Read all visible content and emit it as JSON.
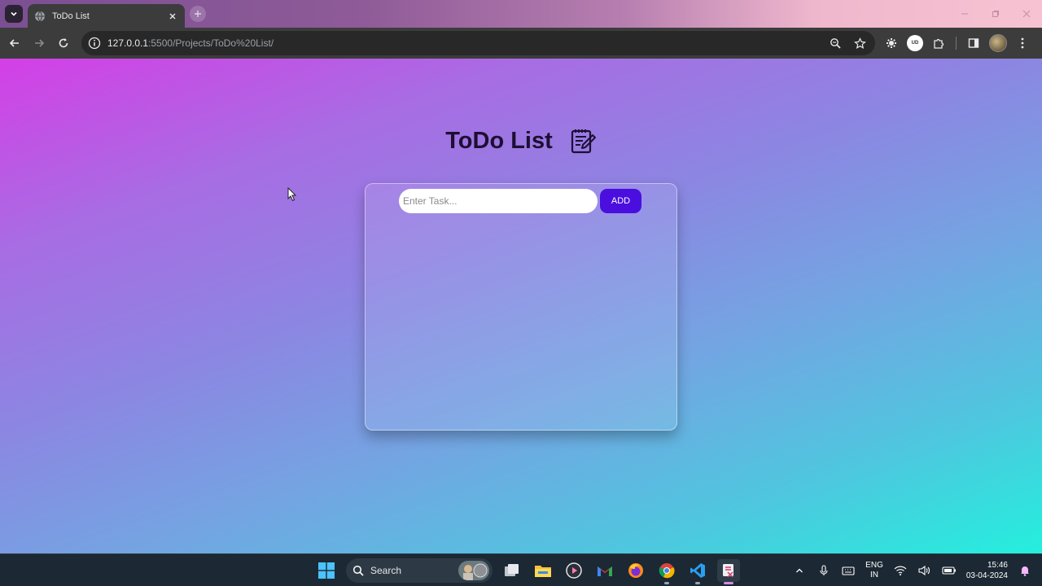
{
  "browser": {
    "tab_title": "ToDo List",
    "url_host": "127.0.0.1",
    "url_rest": ":5500/Projects/ToDo%20List/",
    "extension_badge": "UD"
  },
  "page": {
    "heading": "ToDo List",
    "heading_icon": "notepad-pencil-icon",
    "input_placeholder": "Enter Task...",
    "input_value": "",
    "add_label": "ADD"
  },
  "taskbar": {
    "search_label": "Search",
    "lang_line1": "ENG",
    "lang_line2": "IN",
    "time": "15:46",
    "date": "03-04-2024"
  },
  "colors": {
    "add_button": "#4a0fdf",
    "heading_text": "#1d0f33",
    "gradient_start": "#d43fe6",
    "gradient_end": "#24efdd"
  }
}
